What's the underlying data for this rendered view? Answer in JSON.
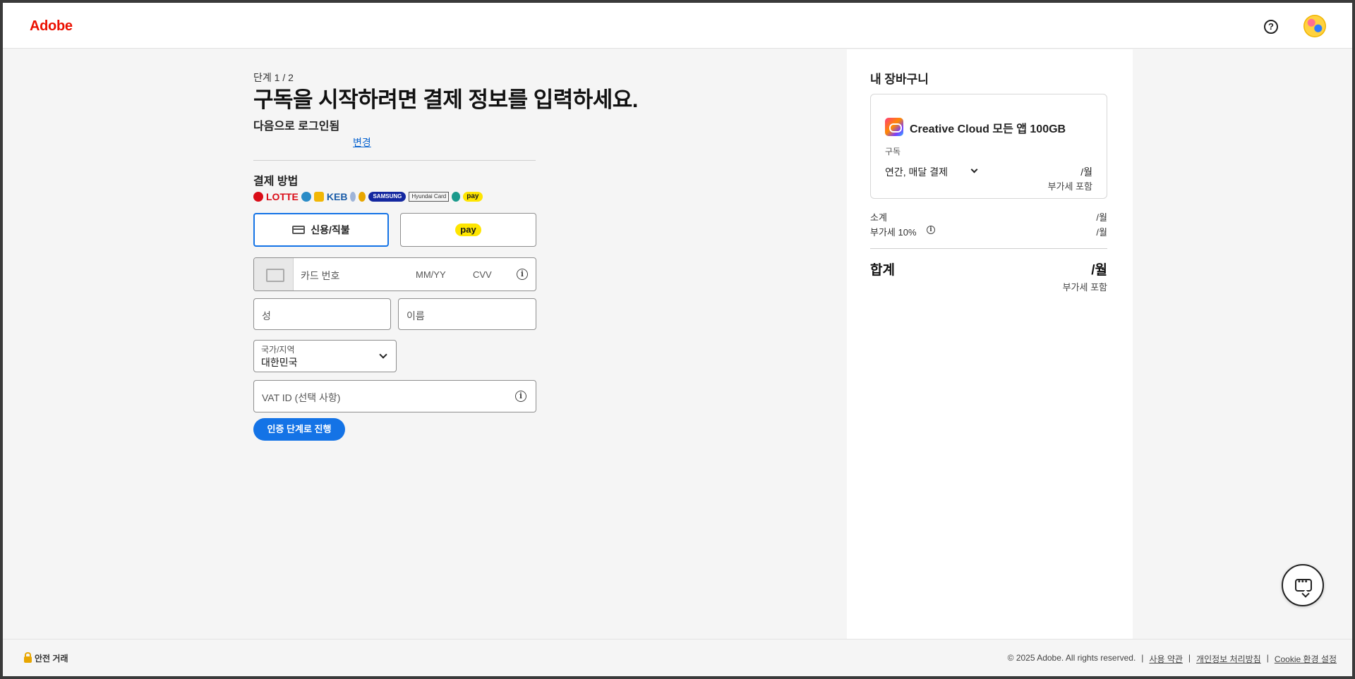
{
  "header": {
    "logo": "Adobe",
    "help_icon": "help-circle-icon",
    "avatar_icon": "user-avatar"
  },
  "form": {
    "step": "단계 1 / 2",
    "title": "구독을 시작하려면 결제 정보를 입력하세요.",
    "logged_in_label": "다음으로 로그인됨",
    "change_link": "변경",
    "payment_method_title": "결제 방법",
    "brands": [
      "LOTTE",
      "KEB",
      "SAMSUNG",
      "Hyundai Card",
      "pay"
    ],
    "tabs": {
      "card": "신용/직불",
      "kakao": "pay"
    },
    "card_number_placeholder": "카드 번호",
    "expiry_placeholder": "MM/YY",
    "cvv_placeholder": "CVV",
    "last_name_placeholder": "성",
    "first_name_placeholder": "이름",
    "country_label": "국가/지역",
    "country_value": "대한민국",
    "vat_placeholder": "VAT ID (선택 사항)",
    "proceed_button": "인증 단계로 진행"
  },
  "cart": {
    "title": "내 장바구니",
    "product": "Creative Cloud 모든 앱 100GB",
    "subscription_label": "구독",
    "plan": "연간, 매달 결제",
    "price_per_month": "/월",
    "vat_included": "부가세 포함",
    "subtotal_label": "소계",
    "subtotal_value": "/월",
    "vat_label": "부가세 10%",
    "vat_value": "/월",
    "total_label": "합계",
    "total_value": "/월",
    "total_vat_included": "부가세 포함"
  },
  "footer": {
    "secure": "안전 거래",
    "copyright": "© 2025 Adobe. All rights reserved.",
    "sep": "|",
    "terms": "사용 약관",
    "privacy": "개인정보 처리방침",
    "cookies": "Cookie 환경 설정"
  },
  "colors": {
    "accent": "#1473e6",
    "brand": "#eb1000",
    "kakao": "#fee500"
  }
}
